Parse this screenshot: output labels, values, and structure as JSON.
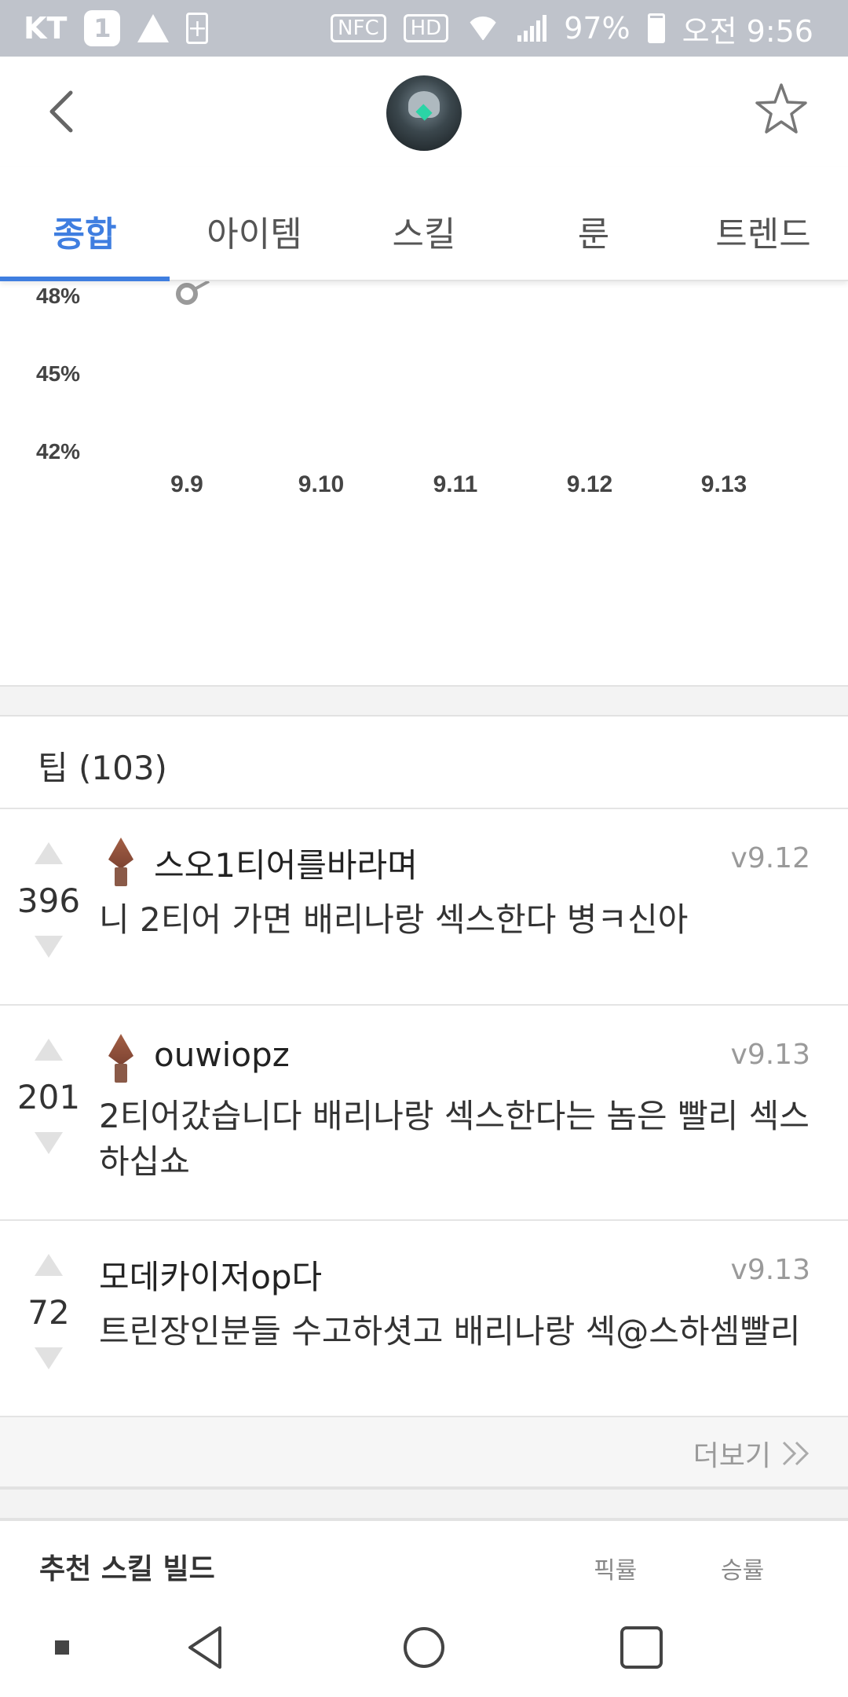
{
  "status_bar": {
    "carrier": "KT",
    "badge": "1",
    "battery": "97%",
    "time": "오전 9:56",
    "nfc_label": "NFC",
    "hd_label": "HD"
  },
  "header": {
    "back_icon": "chevron-left-icon",
    "avatar": "champion-portrait",
    "favorite_icon": "star-outline-icon"
  },
  "tabs": [
    {
      "label": "종합",
      "active": true
    },
    {
      "label": "아이템",
      "active": false
    },
    {
      "label": "스킬",
      "active": false
    },
    {
      "label": "룬",
      "active": false
    },
    {
      "label": "트렌드",
      "active": false
    }
  ],
  "chart_data": {
    "type": "line",
    "y_ticks": [
      "48%",
      "45%",
      "42%"
    ],
    "x": [
      "9.9",
      "9.10",
      "9.11",
      "9.12",
      "9.13"
    ],
    "series": [
      {
        "values": [
          48,
          null,
          null,
          null,
          null
        ]
      }
    ],
    "ylim": [
      42,
      48
    ],
    "colors": {
      "point": "#9a9a9a"
    }
  },
  "tips": {
    "title": "팁 (103)",
    "items": [
      {
        "votes": "396",
        "author": "스오1티어를바라며",
        "version": "v9.12",
        "body": "니 2티어 가면 배리나랑 섹스한다 병ㅋ신아",
        "has_tier_icon": true
      },
      {
        "votes": "201",
        "author": "ouwiopz",
        "version": "v9.13",
        "body": "2티어갔습니다 배리나랑 섹스한다는 놈은 빨리 섹스하십쇼",
        "has_tier_icon": true
      },
      {
        "votes": "72",
        "author": "모데카이저op다",
        "version": "v9.13",
        "body": "트린장인분들 수고하셧고 배리나랑 섹@스하셈빨리",
        "has_tier_icon": false
      }
    ],
    "more_label": "더보기"
  },
  "skill_build": {
    "title": "추천 스킬 빌드",
    "col_pick": "픽률",
    "col_win": "승률"
  },
  "colors": {
    "accent": "#3f7ee0",
    "status_bar": "#bfc3cb",
    "muted": "#9a9a9a"
  }
}
